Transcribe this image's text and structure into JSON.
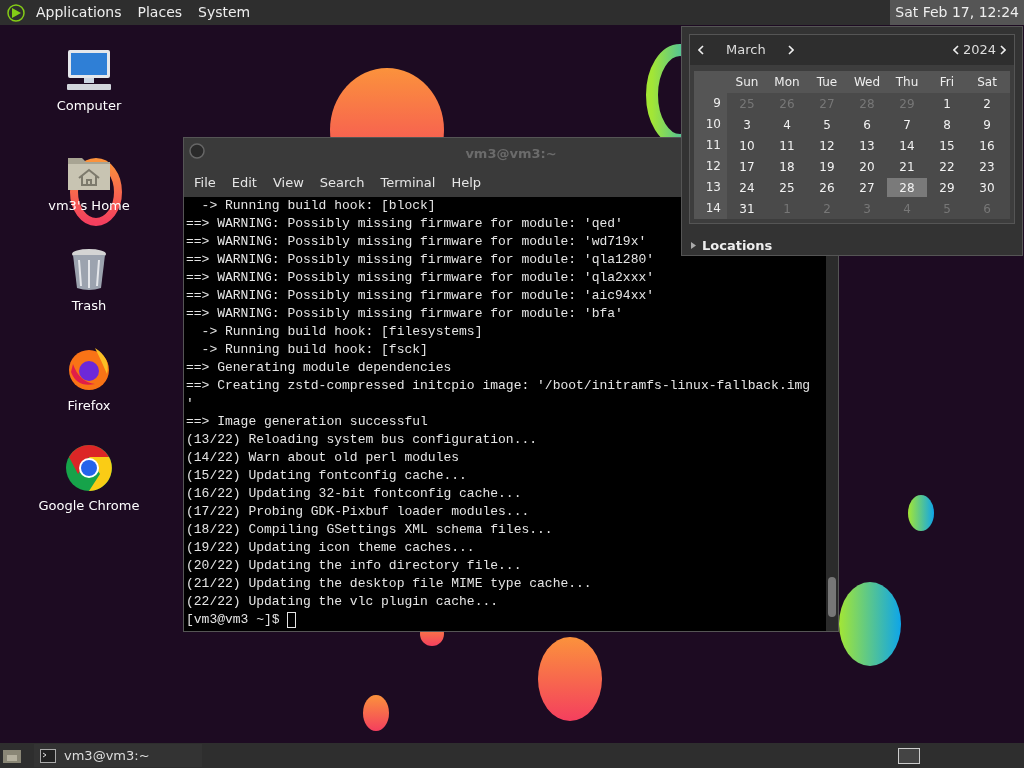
{
  "top_panel": {
    "menus": [
      "Applications",
      "Places",
      "System"
    ],
    "clock": {
      "text": "Sat Feb 17, 12:24",
      "selected": true
    }
  },
  "desktop_icons": [
    {
      "kind": "computer",
      "label": "Computer"
    },
    {
      "kind": "home",
      "label": "vm3's Home"
    },
    {
      "kind": "trash",
      "label": "Trash"
    },
    {
      "kind": "firefox",
      "label": "Firefox"
    },
    {
      "kind": "chrome",
      "label": "Google Chrome"
    }
  ],
  "terminal": {
    "title": "vm3@vm3:~",
    "menu": [
      "File",
      "Edit",
      "View",
      "Search",
      "Terminal",
      "Help"
    ],
    "lines": [
      "  -> Running build hook: [block]",
      "==> WARNING: Possibly missing firmware for module: 'qed'",
      "==> WARNING: Possibly missing firmware for module: 'wd719x'",
      "==> WARNING: Possibly missing firmware for module: 'qla1280'",
      "==> WARNING: Possibly missing firmware for module: 'qla2xxx'",
      "==> WARNING: Possibly missing firmware for module: 'aic94xx'",
      "==> WARNING: Possibly missing firmware for module: 'bfa'",
      "  -> Running build hook: [filesystems]",
      "  -> Running build hook: [fsck]",
      "==> Generating module dependencies",
      "==> Creating zstd-compressed initcpio image: '/boot/initramfs-linux-fallback.img",
      "'",
      "==> Image generation successful",
      "(13/22) Reloading system bus configuration...",
      "(14/22) Warn about old perl modules",
      "(15/22) Updating fontconfig cache...",
      "(16/22) Updating 32-bit fontconfig cache...",
      "(17/22) Probing GDK-Pixbuf loader modules...",
      "(18/22) Compiling GSettings XML schema files...",
      "(19/22) Updating icon theme caches...",
      "(20/22) Updating the info directory file...",
      "(21/22) Updating the desktop file MIME type cache...",
      "(22/22) Updating the vlc plugin cache..."
    ],
    "prompt": "[vm3@vm3 ~]$ "
  },
  "calendar": {
    "month": "March",
    "year": "2024",
    "weekdays": [
      "Sun",
      "Mon",
      "Tue",
      "Wed",
      "Thu",
      "Fri",
      "Sat"
    ],
    "weeks": [
      {
        "week": "9",
        "days": [
          {
            "text": "25",
            "dim": true,
            "selected": false
          },
          {
            "text": "26",
            "dim": true,
            "selected": false
          },
          {
            "text": "27",
            "dim": true,
            "selected": false
          },
          {
            "text": "28",
            "dim": true,
            "selected": false
          },
          {
            "text": "29",
            "dim": true,
            "selected": false
          },
          {
            "text": "1",
            "dim": false,
            "selected": false
          },
          {
            "text": "2",
            "dim": false,
            "selected": false
          }
        ]
      },
      {
        "week": "10",
        "days": [
          {
            "text": "3",
            "dim": false,
            "selected": false
          },
          {
            "text": "4",
            "dim": false,
            "selected": false
          },
          {
            "text": "5",
            "dim": false,
            "selected": false
          },
          {
            "text": "6",
            "dim": false,
            "selected": false
          },
          {
            "text": "7",
            "dim": false,
            "selected": false
          },
          {
            "text": "8",
            "dim": false,
            "selected": false
          },
          {
            "text": "9",
            "dim": false,
            "selected": false
          }
        ]
      },
      {
        "week": "11",
        "days": [
          {
            "text": "10",
            "dim": false,
            "selected": false
          },
          {
            "text": "11",
            "dim": false,
            "selected": false
          },
          {
            "text": "12",
            "dim": false,
            "selected": false
          },
          {
            "text": "13",
            "dim": false,
            "selected": false
          },
          {
            "text": "14",
            "dim": false,
            "selected": false
          },
          {
            "text": "15",
            "dim": false,
            "selected": false
          },
          {
            "text": "16",
            "dim": false,
            "selected": false
          }
        ]
      },
      {
        "week": "12",
        "days": [
          {
            "text": "17",
            "dim": false,
            "selected": false
          },
          {
            "text": "18",
            "dim": false,
            "selected": false
          },
          {
            "text": "19",
            "dim": false,
            "selected": false
          },
          {
            "text": "20",
            "dim": false,
            "selected": false
          },
          {
            "text": "21",
            "dim": false,
            "selected": false
          },
          {
            "text": "22",
            "dim": false,
            "selected": false
          },
          {
            "text": "23",
            "dim": false,
            "selected": false
          }
        ]
      },
      {
        "week": "13",
        "days": [
          {
            "text": "24",
            "dim": false,
            "selected": false
          },
          {
            "text": "25",
            "dim": false,
            "selected": false
          },
          {
            "text": "26",
            "dim": false,
            "selected": false
          },
          {
            "text": "27",
            "dim": false,
            "selected": false
          },
          {
            "text": "28",
            "dim": false,
            "selected": true
          },
          {
            "text": "29",
            "dim": false,
            "selected": false
          },
          {
            "text": "30",
            "dim": false,
            "selected": false
          }
        ]
      },
      {
        "week": "14",
        "days": [
          {
            "text": "31",
            "dim": false,
            "selected": false
          },
          {
            "text": "1",
            "dim": true,
            "selected": false
          },
          {
            "text": "2",
            "dim": true,
            "selected": false
          },
          {
            "text": "3",
            "dim": true,
            "selected": false
          },
          {
            "text": "4",
            "dim": true,
            "selected": false
          },
          {
            "text": "5",
            "dim": true,
            "selected": false
          },
          {
            "text": "6",
            "dim": true,
            "selected": false
          }
        ]
      }
    ],
    "locations": {
      "label": "Locations",
      "expanded": false
    }
  },
  "taskbar": {
    "tasks": [
      {
        "label": "vm3@vm3:~",
        "selected": false
      }
    ]
  }
}
